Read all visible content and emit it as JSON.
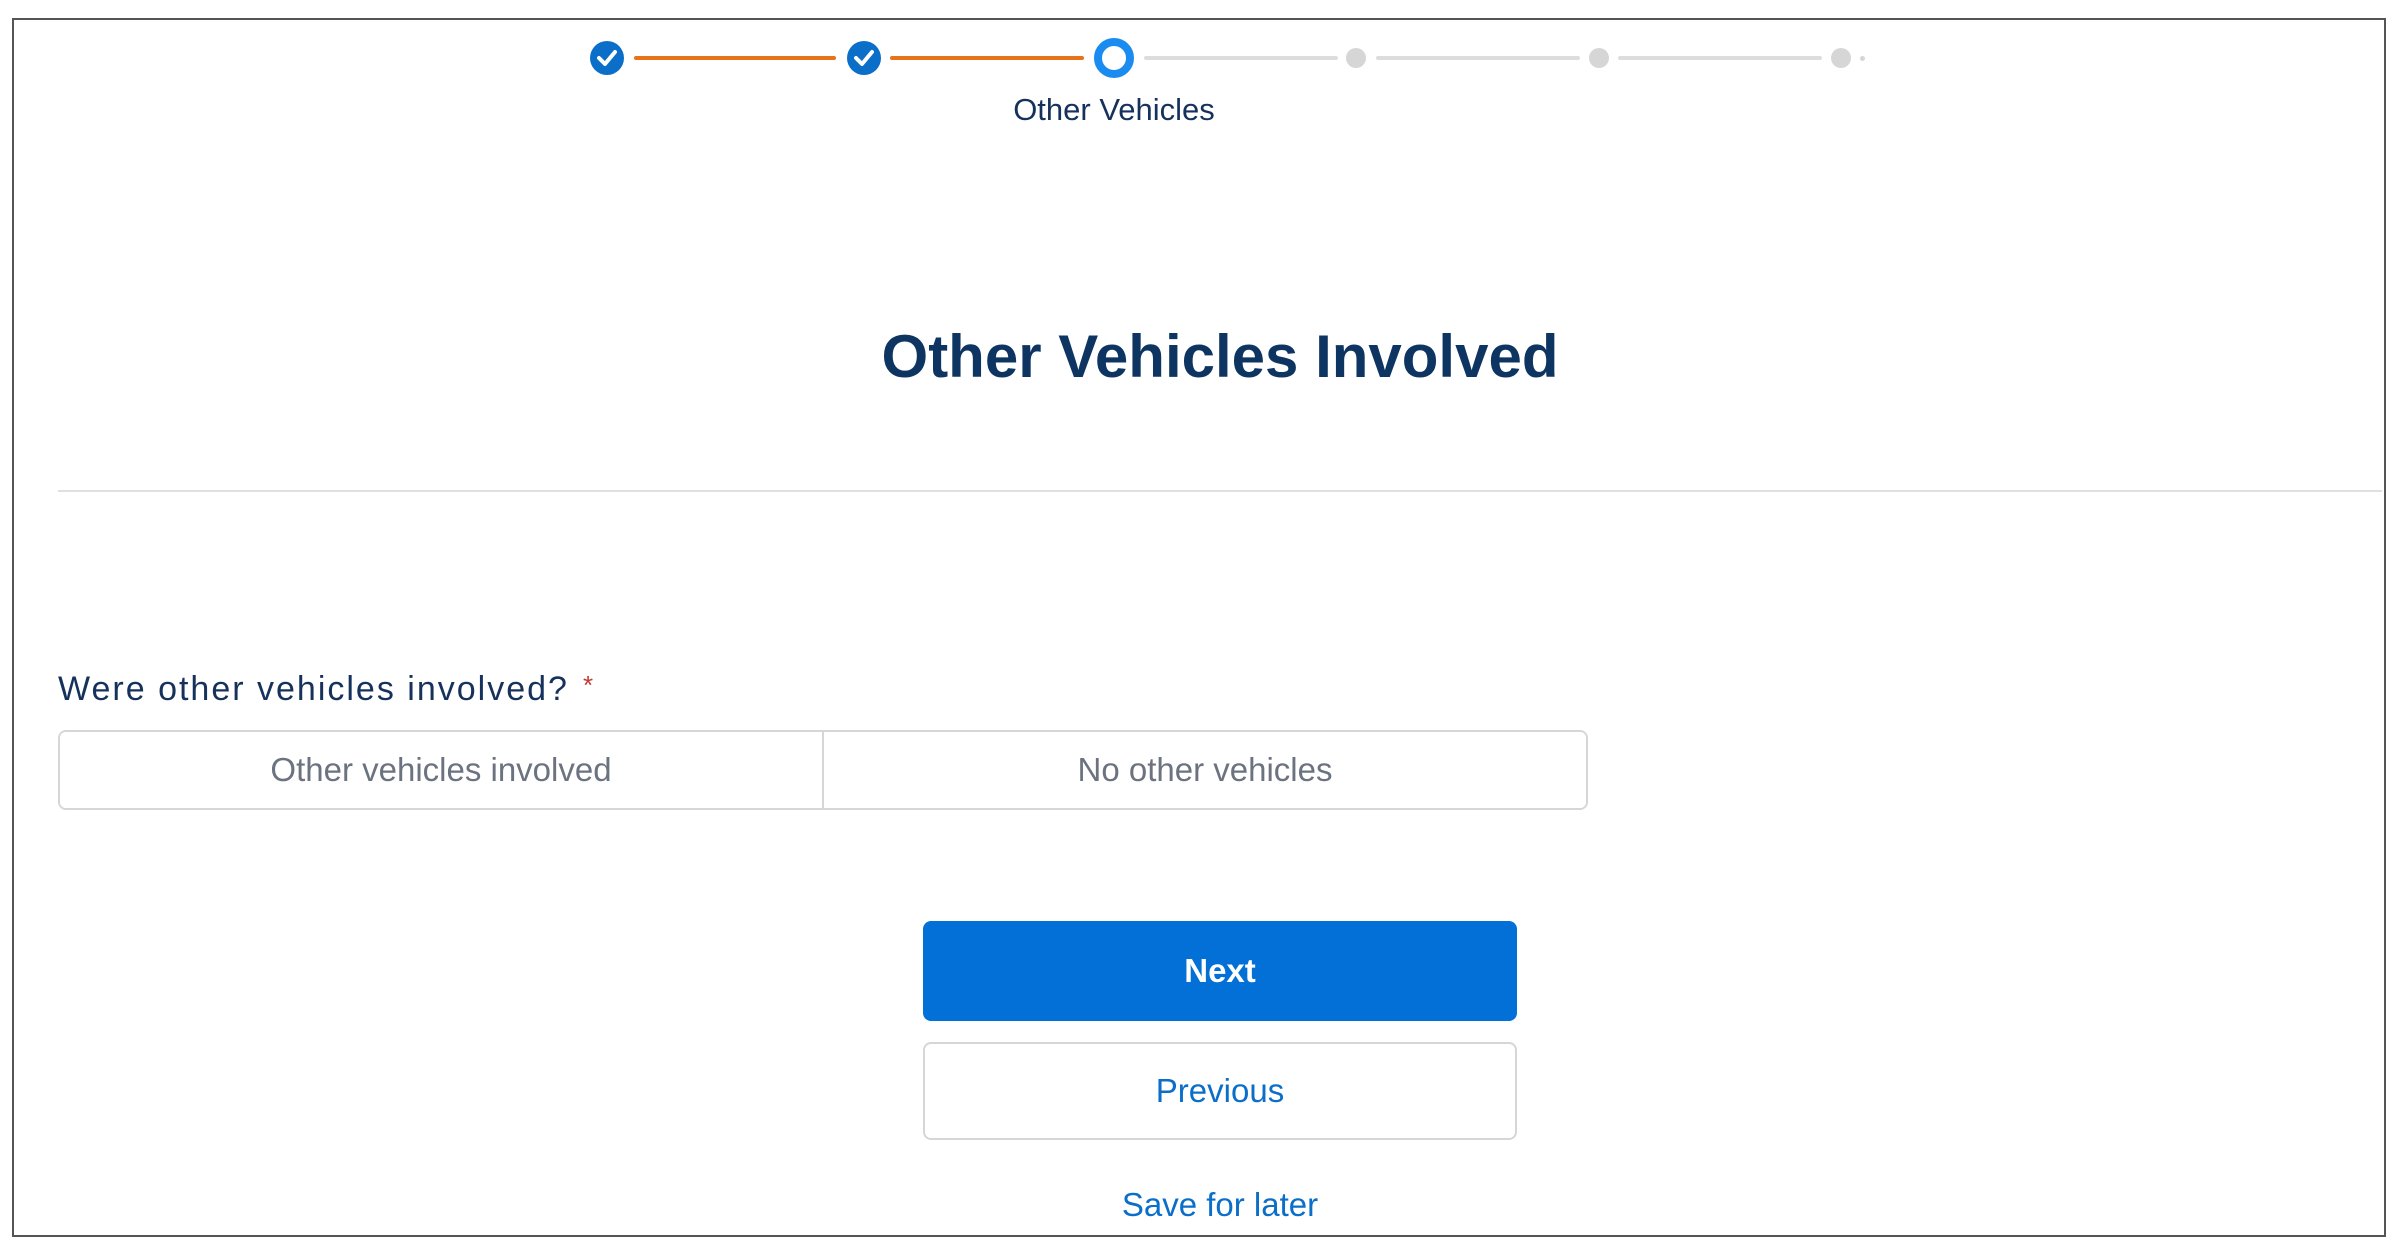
{
  "stepper": {
    "current_step_label": "Other Vehicles",
    "colors": {
      "complete": "#0b6ec9",
      "current": "#1a8cf0",
      "progress_line": "#e8731a",
      "upcoming": "#d6d6d6"
    }
  },
  "page": {
    "title": "Other Vehicles Involved"
  },
  "question": {
    "label": "Were other vehicles involved?",
    "required_marker": "*",
    "options": [
      "Other vehicles involved",
      "No other vehicles"
    ]
  },
  "actions": {
    "next_label": "Next",
    "previous_label": "Previous",
    "save_label": "Save for later"
  }
}
